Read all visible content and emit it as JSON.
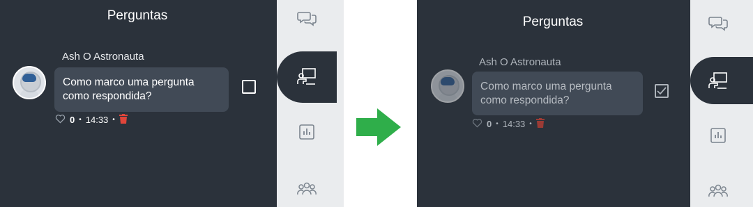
{
  "before": {
    "header": {
      "title": "Perguntas"
    },
    "question": {
      "author": "Ash O Astronauta",
      "text_line1": "Como marco uma pergunta",
      "text_line2": "como respondida?",
      "likes": "0",
      "time": "14:33",
      "answered": false
    },
    "rail": {
      "icons": [
        "chat-bubbles-icon",
        "presentation-icon",
        "chart-icon",
        "group-icon"
      ],
      "active": "presentation-icon"
    }
  },
  "after": {
    "header": {
      "title": "Perguntas"
    },
    "question": {
      "author": "Ash O Astronauta",
      "text_line1": "Como marco uma pergunta",
      "text_line2": "como respondida?",
      "likes": "0",
      "time": "14:33",
      "answered": true
    },
    "rail": {
      "icons": [
        "chat-bubbles-icon",
        "presentation-icon",
        "chart-icon",
        "group-icon"
      ],
      "active": "presentation-icon"
    }
  },
  "colors": {
    "panel_bg": "#2b323b",
    "bubble_bg": "#414a56",
    "rail_bg": "#eaecee",
    "delete_red": "#e0453a",
    "arrow_green": "#2fae4a",
    "avatar_visor": "#2f5f97"
  },
  "transition_arrow": "right-arrow-icon"
}
